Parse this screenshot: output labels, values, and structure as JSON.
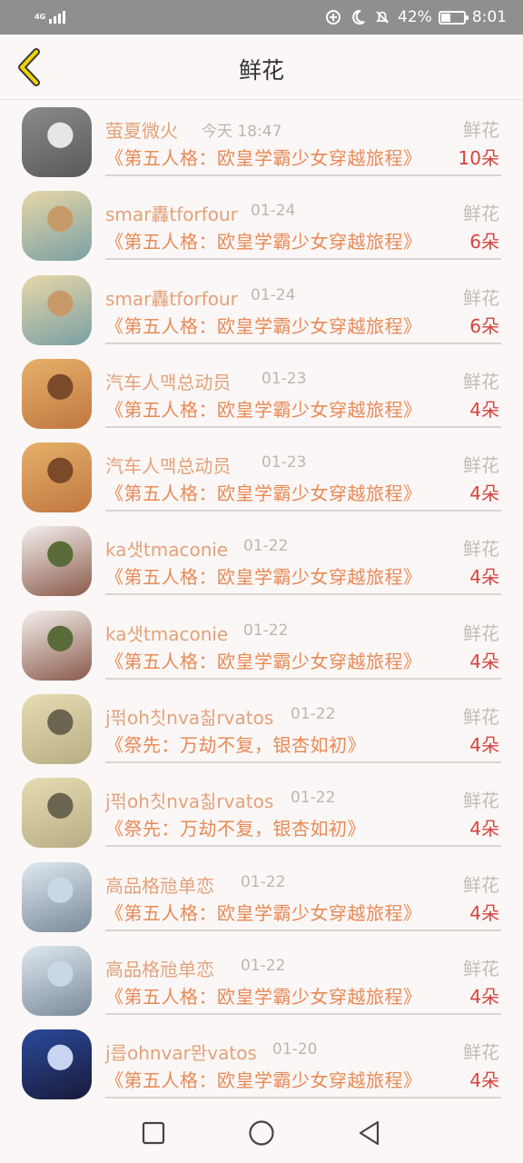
{
  "status_bar": {
    "network": "4G",
    "battery_percent": "42%",
    "battery_level": 0.42,
    "time": "8:01",
    "icons": [
      "signal-icon",
      "data-saver-icon",
      "moon-icon",
      "bell-off-icon",
      "battery-icon"
    ]
  },
  "header": {
    "title": "鲜花",
    "back_icon": "chevron-left-icon"
  },
  "colors": {
    "name": "#e3a27b",
    "work": "#e88a57",
    "count": "#d4443e",
    "back": "#f2d300"
  },
  "items": [
    {
      "name": "萤夏微火",
      "date": "今天 18:47",
      "type": "鲜花",
      "work": "《第五人格：欧皇学霸少女穿越旅程》",
      "count": "10朵"
    },
    {
      "name": "smar轟tforfour",
      "date": "01-24",
      "type": "鲜花",
      "work": "《第五人格：欧皇学霸少女穿越旅程》",
      "count": "6朵"
    },
    {
      "name": "smar轟tforfour",
      "date": "01-24",
      "type": "鲜花",
      "work": "《第五人格：欧皇学霸少女穿越旅程》",
      "count": "6朵"
    },
    {
      "name": "汽车人맥总动员",
      "date": "01-23",
      "type": "鲜花",
      "work": "《第五人格：欧皇学霸少女穿越旅程》",
      "count": "4朵"
    },
    {
      "name": "汽车人맥总动员",
      "date": "01-23",
      "type": "鲜花",
      "work": "《第五人格：欧皇学霸少女穿越旅程》",
      "count": "4朵"
    },
    {
      "name": "ka샛tmaconie",
      "date": "01-22",
      "type": "鲜花",
      "work": "《第五人格：欧皇学霸少女穿越旅程》",
      "count": "4朵"
    },
    {
      "name": "ka샛tmaconie",
      "date": "01-22",
      "type": "鲜花",
      "work": "《第五人格：欧皇学霸少女穿越旅程》",
      "count": "4朵"
    },
    {
      "name": "j퍾oh칫nva칢rvatos",
      "date": "01-22",
      "type": "鲜花",
      "work": "《祭先：万劫不复，银杏如初》",
      "count": "4朵"
    },
    {
      "name": "j퍾oh칫nva칢rvatos",
      "date": "01-22",
      "type": "鲜花",
      "work": "《祭先：万劫不复，银杏如初》",
      "count": "4朵"
    },
    {
      "name": "高品格兘单恋",
      "date": "01-22",
      "type": "鲜花",
      "work": "《第五人格：欧皇学霸少女穿越旅程》",
      "count": "4朵"
    },
    {
      "name": "高品格兘单恋",
      "date": "01-22",
      "type": "鲜花",
      "work": "《第五人格：欧皇学霸少女穿越旅程》",
      "count": "4朵"
    },
    {
      "name": "j릅ohnvar뫈vatos",
      "date": "01-20",
      "type": "鲜花",
      "work": "《第五人格：欧皇学霸少女穿越旅程》",
      "count": "4朵"
    }
  ],
  "nav": {
    "recent_icon": "square-recent-apps-icon",
    "home_icon": "circle-home-icon",
    "back_icon": "triangle-back-icon"
  }
}
